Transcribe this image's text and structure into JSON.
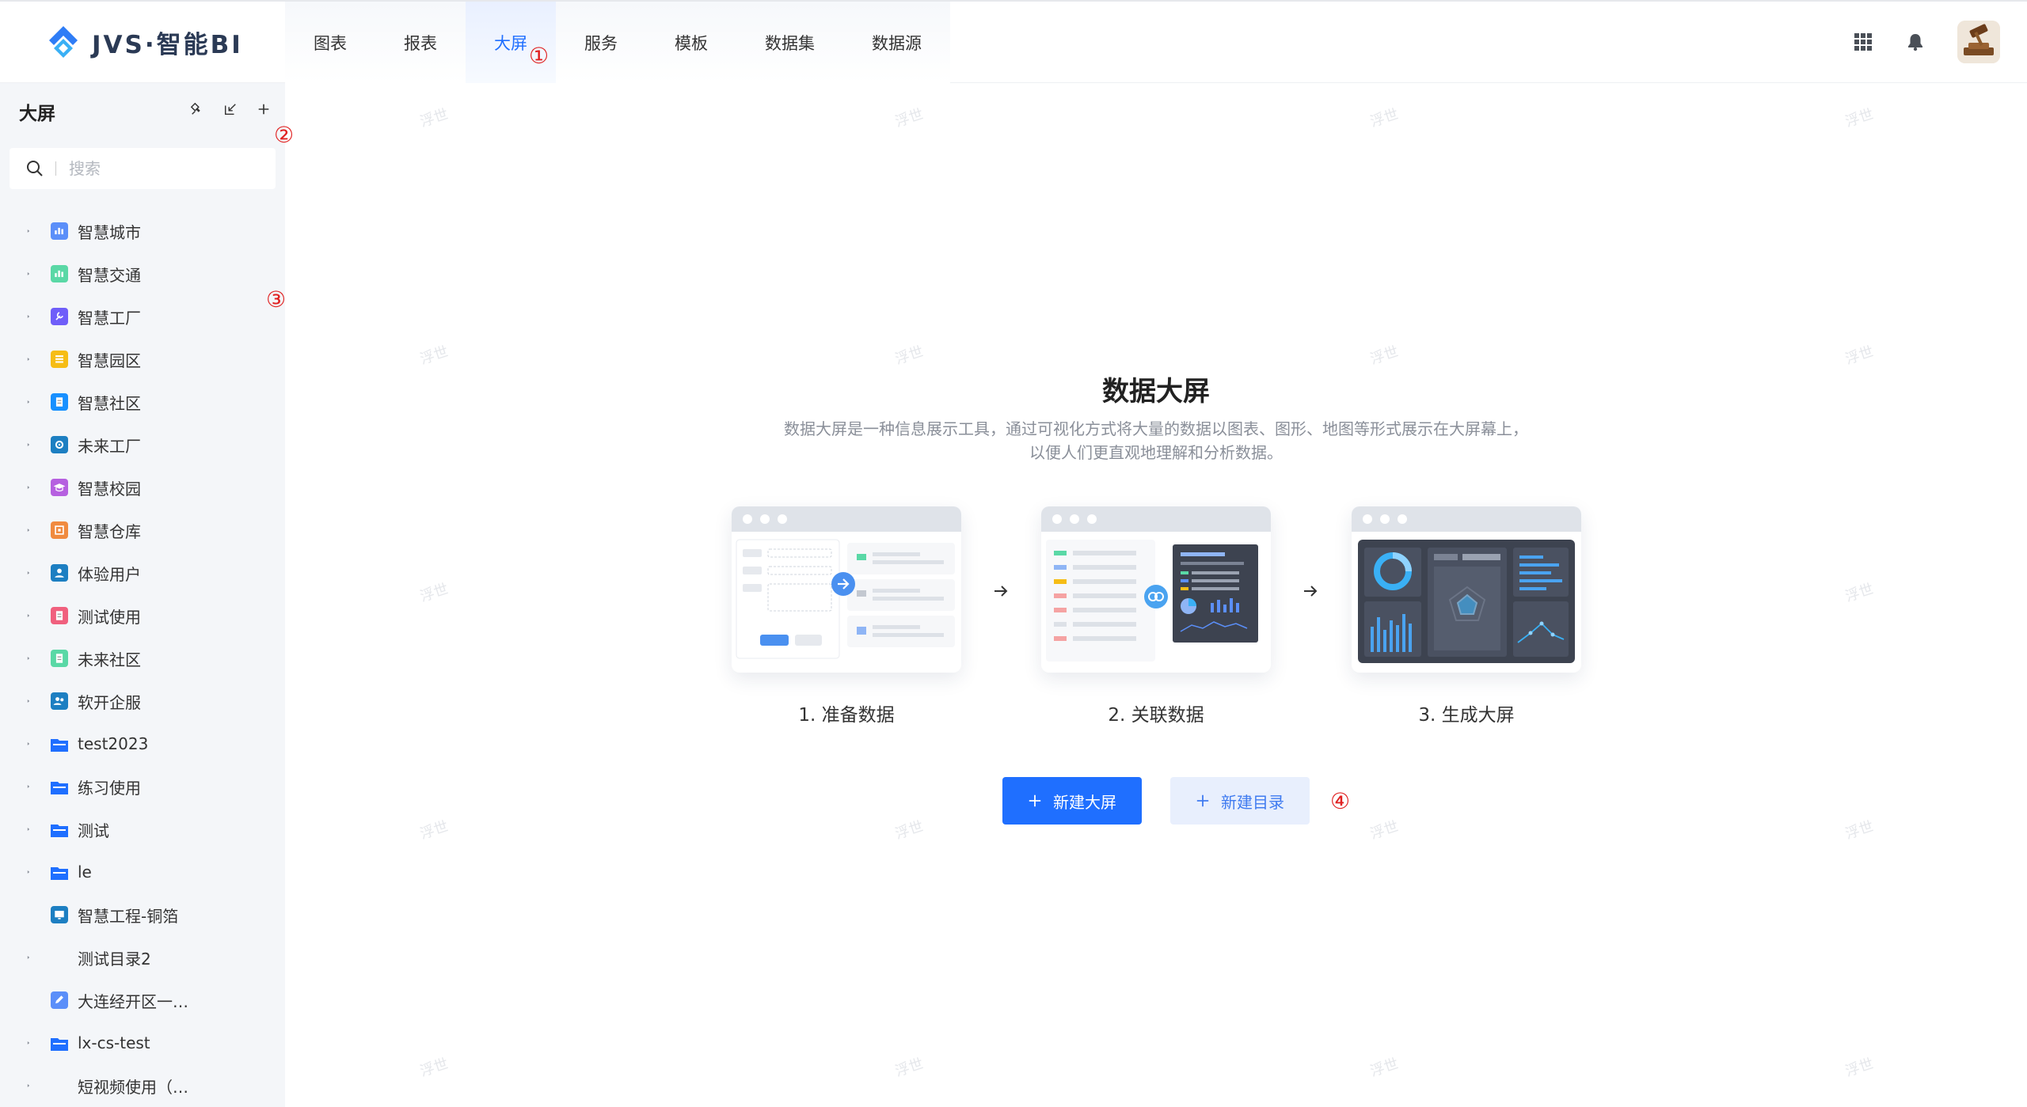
{
  "app": {
    "logo_text": "JVS·智能BI"
  },
  "nav": {
    "items": [
      "图表",
      "报表",
      "大屏",
      "服务",
      "模板",
      "数据集",
      "数据源"
    ],
    "active_index": 2
  },
  "sidebar": {
    "title": "大屏",
    "search_placeholder": "搜索",
    "items": [
      {
        "label": "智慧城市",
        "color": "#5b8ff9",
        "caret": true,
        "kind": "chart"
      },
      {
        "label": "智慧交通",
        "color": "#5ad8a6",
        "caret": true,
        "kind": "chart"
      },
      {
        "label": "智慧工厂",
        "color": "#6f5ef9",
        "caret": true,
        "kind": "wrench"
      },
      {
        "label": "智慧园区",
        "color": "#f6bd16",
        "caret": true,
        "kind": "list"
      },
      {
        "label": "智慧社区",
        "color": "#1890ff",
        "caret": true,
        "kind": "doc"
      },
      {
        "label": "未来工厂",
        "color": "#1d7fc2",
        "caret": true,
        "kind": "gear"
      },
      {
        "label": "智慧校园",
        "color": "#b660e0",
        "caret": true,
        "kind": "cap"
      },
      {
        "label": "智慧仓库",
        "color": "#f08b3f",
        "caret": true,
        "kind": "box"
      },
      {
        "label": "体验用户",
        "color": "#1d7fc2",
        "caret": true,
        "kind": "user"
      },
      {
        "label": "测试使用",
        "color": "#f0607e",
        "caret": true,
        "kind": "doc"
      },
      {
        "label": "未来社区",
        "color": "#5ad8a6",
        "caret": true,
        "kind": "doc"
      },
      {
        "label": "软开企服",
        "color": "#1d7fc2",
        "caret": true,
        "kind": "users"
      },
      {
        "label": "test2023",
        "color": "#1f6fff",
        "caret": true,
        "kind": "folder"
      },
      {
        "label": "练习使用",
        "color": "#1f6fff",
        "caret": true,
        "kind": "folder"
      },
      {
        "label": "测试",
        "color": "#1f6fff",
        "caret": true,
        "kind": "folder"
      },
      {
        "label": "le",
        "color": "#1f6fff",
        "caret": true,
        "kind": "folder"
      },
      {
        "label": "智慧工程-铜箔",
        "color": "#1d7fc2",
        "caret": false,
        "kind": "screen"
      },
      {
        "label": "测试目录2",
        "color": "",
        "caret": true,
        "kind": "none"
      },
      {
        "label": "大连经开区一…",
        "color": "#5b8ff9",
        "caret": false,
        "kind": "edit"
      },
      {
        "label": "lx-cs-test",
        "color": "#1f6fff",
        "caret": true,
        "kind": "folder"
      },
      {
        "label": "短视频使用（…",
        "color": "",
        "caret": true,
        "kind": "none"
      }
    ]
  },
  "main": {
    "title": "数据大屏",
    "description": "数据大屏是一种信息展示工具，通过可视化方式将大量的数据以图表、图形、地图等形式展示在大屏幕上，以便人们更直观地理解和分析数据。",
    "steps": [
      "1. 准备数据",
      "2. 关联数据",
      "3. 生成大屏"
    ],
    "buttons": {
      "new_screen": "新建大屏",
      "new_folder": "新建目录"
    }
  },
  "watermark": "浮世",
  "annotations": [
    "①",
    "②",
    "③",
    "④"
  ],
  "colors": {
    "primary": "#1f6fff",
    "annotation": "#e02020"
  }
}
